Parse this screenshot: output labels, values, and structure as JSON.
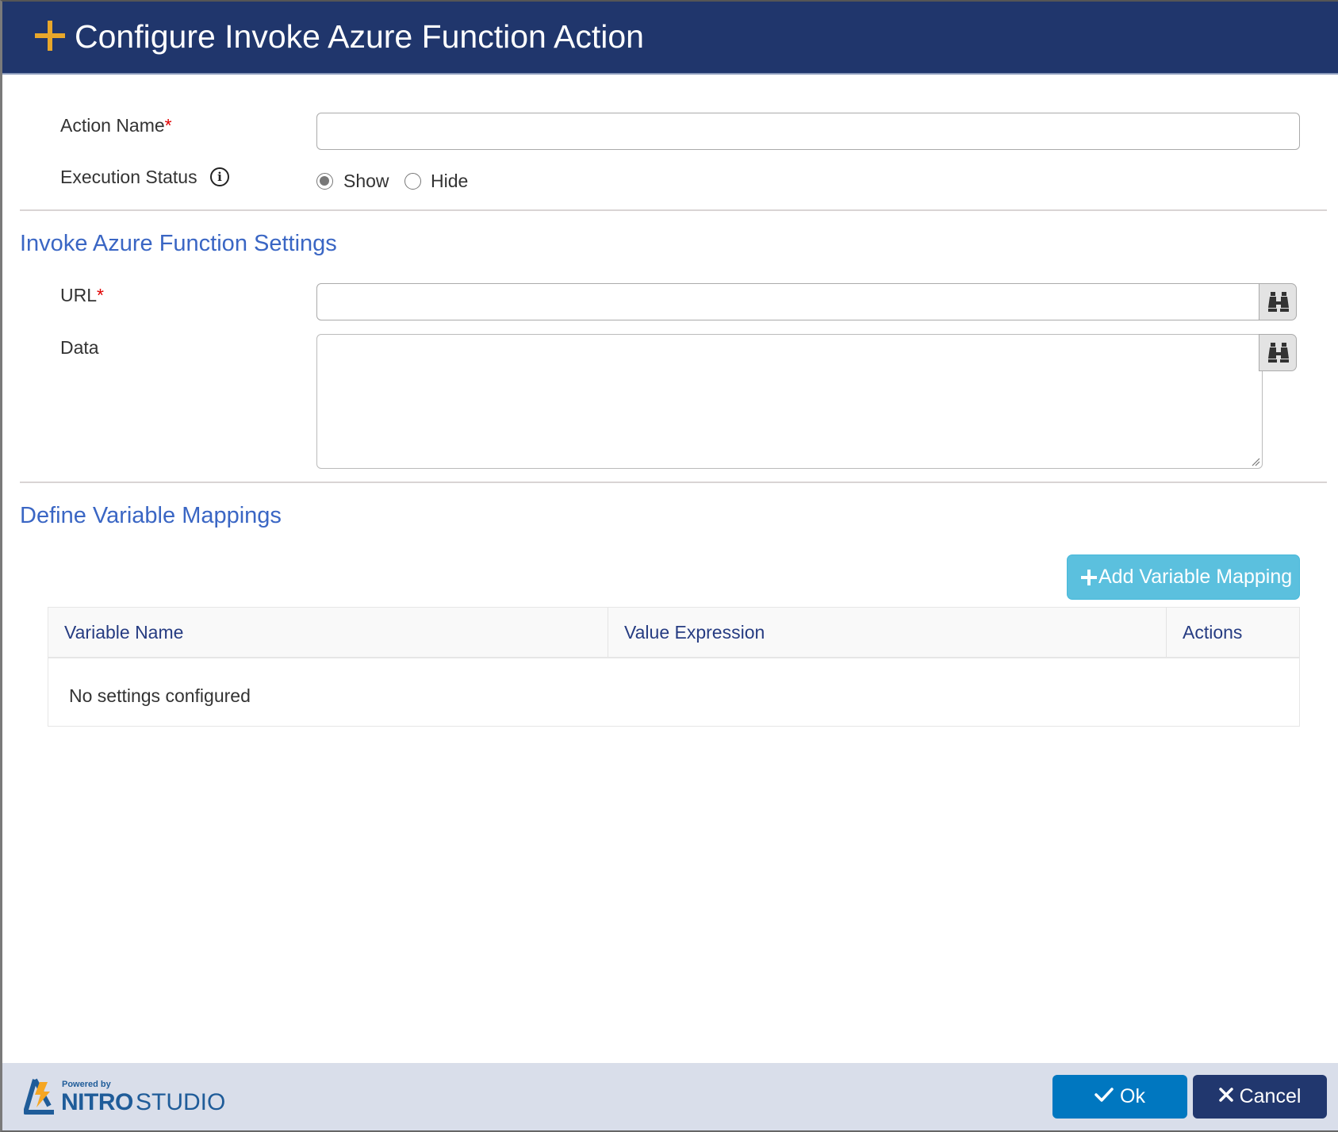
{
  "dialog": {
    "title": "Configure Invoke Azure Function Action",
    "title_icon": "plus-icon",
    "accent_color": "#e8a72b",
    "header_color": "#20366c"
  },
  "general": {
    "action_name": {
      "label": "Action Name",
      "required_mark": "*",
      "value": "",
      "placeholder": ""
    },
    "execution_status": {
      "label": "Execution Status",
      "info_icon": "info-icon",
      "info_glyph": "i",
      "options": [
        {
          "label": "Show",
          "checked": true
        },
        {
          "label": "Hide",
          "checked": false
        }
      ]
    }
  },
  "settings": {
    "section_title": "Invoke Azure Function Settings",
    "url": {
      "label": "URL",
      "required_mark": "*",
      "value": "",
      "lookup_icon": "binoculars-icon"
    },
    "data": {
      "label": "Data",
      "value": "",
      "lookup_icon": "binoculars-icon"
    }
  },
  "mappings": {
    "section_title": "Define Variable Mappings",
    "add_button_label": "Add Variable Mapping",
    "add_button_color": "#5bc0de",
    "columns": [
      "Variable Name",
      "Value Expression",
      "Actions"
    ],
    "rows": [],
    "empty_message": "No settings configured"
  },
  "footer": {
    "logo": {
      "powered_by": "Powered by",
      "brand_bold": "NITRO",
      "brand_light": "STUDIO"
    },
    "ok_label": "Ok",
    "ok_icon": "check-icon",
    "ok_color": "#0077c0",
    "cancel_label": "Cancel",
    "cancel_icon": "close-icon",
    "cancel_color": "#21376e"
  }
}
